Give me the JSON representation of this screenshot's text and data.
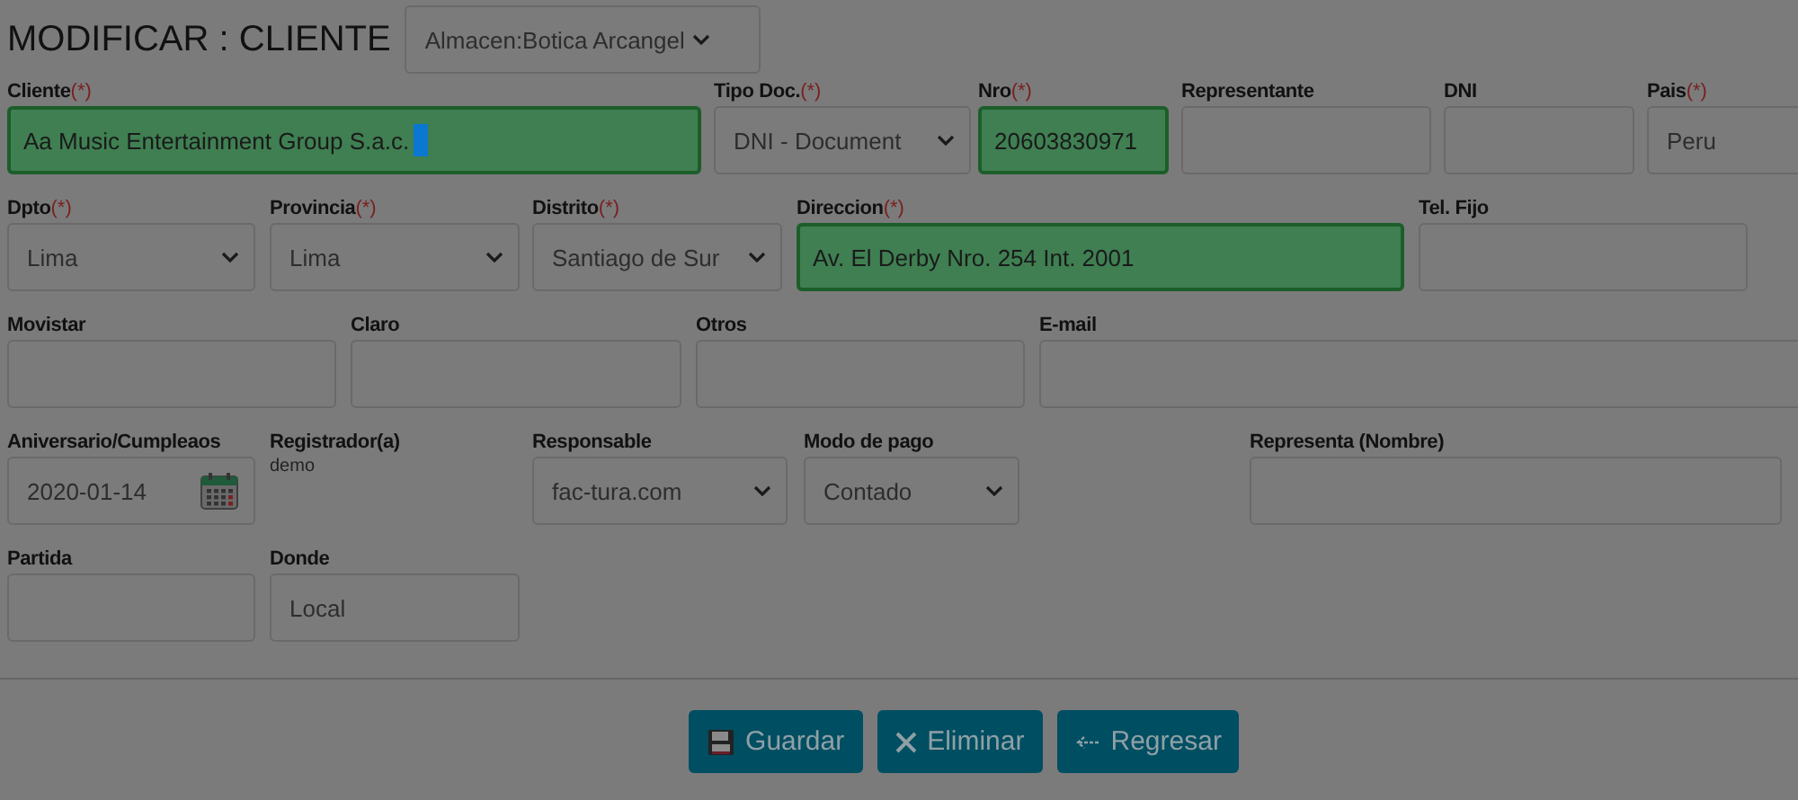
{
  "title": "MODIFICAR : CLIENTE",
  "almacen": {
    "value": "Almacen:Botica Arcangel"
  },
  "rows": [
    [
      {
        "label": "Cliente",
        "required_mark": "(*)",
        "kind": "input",
        "value": "Aa Music Entertainment Group S.a.c.",
        "valid": true,
        "focused": true
      },
      {
        "label": "Tipo Doc.",
        "required_mark": "(*)",
        "kind": "select",
        "value": "DNI - Document",
        "valid": false
      },
      {
        "label": "Nro",
        "required_mark": "(*)",
        "kind": "input",
        "value": "20603830971",
        "valid": true
      },
      {
        "label": "Representante",
        "kind": "input",
        "valid": false
      },
      {
        "label": "DNI",
        "kind": "input",
        "valid": false
      },
      {
        "label": "Pais",
        "required_mark": "(*)",
        "kind": "input",
        "value": "Peru",
        "valid": false
      }
    ],
    [
      {
        "label": "Dpto",
        "required_mark": "(*)",
        "kind": "select",
        "value": "Lima",
        "valid": false
      },
      {
        "label": "Provincia",
        "required_mark": "(*)",
        "kind": "select",
        "value": "Lima",
        "valid": false
      },
      {
        "label": "Distrito",
        "required_mark": "(*)",
        "kind": "select",
        "value": "Santiago de Sur",
        "valid": false
      },
      {
        "label": "Direccion",
        "required_mark": "(*)",
        "kind": "input",
        "value": "Av. El Derby Nro. 254 Int. 2001",
        "valid": true
      },
      {
        "label": "Tel. Fijo",
        "kind": "input",
        "valid": false
      }
    ],
    [
      {
        "label": "Movistar",
        "kind": "input",
        "valid": false
      },
      {
        "label": "Claro",
        "kind": "input",
        "valid": false
      },
      {
        "label": "Otros",
        "kind": "input",
        "valid": false
      },
      {
        "label": "E-mail",
        "kind": "input",
        "valid": false
      }
    ],
    [
      {
        "label": "Aniversario/Cumpleaos",
        "kind": "date",
        "value": "2020-01-14",
        "valid": false
      },
      {
        "label": "Registrador(a)",
        "kind": "text",
        "value": "demo"
      },
      {
        "label": "Responsable",
        "kind": "select",
        "value": "fac-tura.com",
        "valid": false
      },
      {
        "label": "Modo de pago",
        "kind": "select",
        "value": "Contado",
        "valid": false
      },
      {
        "label": "Representa (Nombre)",
        "kind": "input",
        "valid": false
      }
    ],
    [
      {
        "label": "Partida",
        "kind": "input",
        "valid": false
      },
      {
        "label": "Donde",
        "kind": "input",
        "value": "Local",
        "valid": false
      }
    ]
  ],
  "buttons": [
    {
      "label": "Guardar"
    },
    {
      "label": "Eliminar"
    },
    {
      "label": "Regresar"
    }
  ]
}
